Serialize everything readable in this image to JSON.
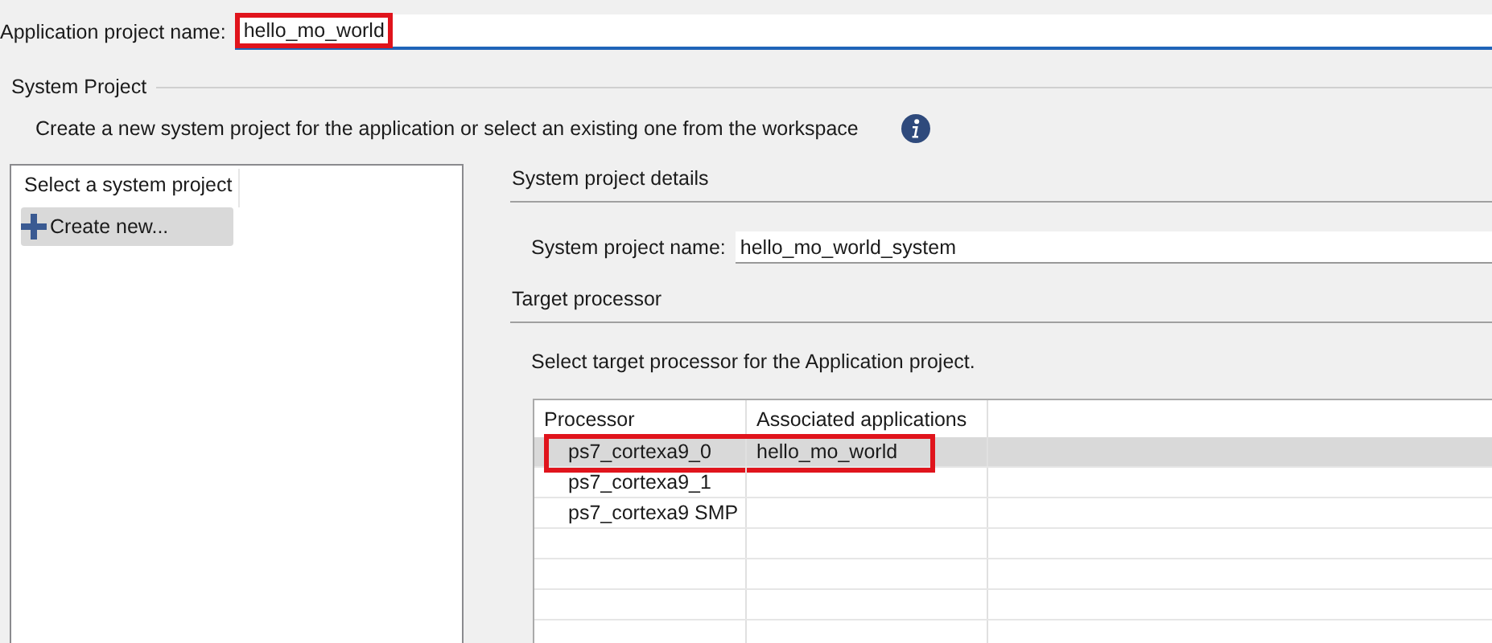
{
  "application_project_name": {
    "label": "Application project name:",
    "value": "hello_mo_world",
    "highlighted": true
  },
  "system_project": {
    "title": "System Project",
    "description": "Create a new system project for the application or select an existing one from the workspace",
    "list": {
      "header": "Select a system project",
      "items": [
        {
          "label": "Create new...",
          "selected": true
        }
      ]
    },
    "details": {
      "title": "System project details",
      "name_label": "System project name:",
      "name_value": "hello_mo_world_system"
    },
    "target_processor": {
      "title": "Target processor",
      "instruction": "Select target processor for the Application project.",
      "table": {
        "columns": [
          "Processor",
          "Associated applications"
        ],
        "rows": [
          {
            "processor": "ps7_cortexa9_0",
            "applications": "hello_mo_world",
            "selected": true,
            "highlighted": true
          },
          {
            "processor": "ps7_cortexa9_1",
            "applications": "",
            "selected": false,
            "highlighted": false
          },
          {
            "processor": "ps7_cortexa9 SMP",
            "applications": "",
            "selected": false,
            "highlighted": false
          }
        ]
      }
    }
  }
}
